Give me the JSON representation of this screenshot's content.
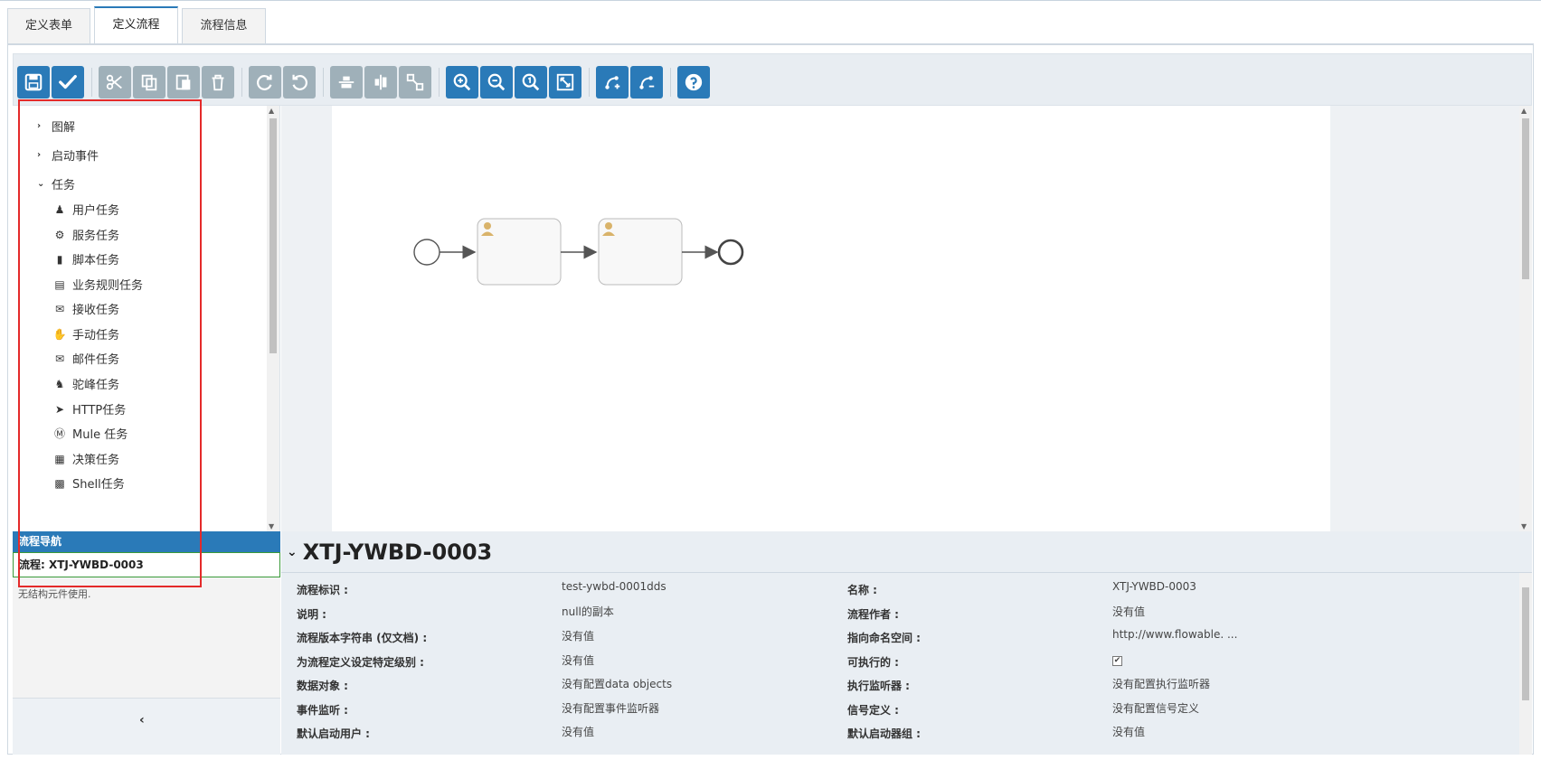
{
  "tabs": [
    {
      "label": "定义表单"
    },
    {
      "label": "定义流程"
    },
    {
      "label": "流程信息"
    }
  ],
  "toolbar": {
    "buttons": [
      "save-icon",
      "check-icon",
      "cut-icon",
      "copy-icon",
      "paste-icon",
      "delete-icon",
      "redo-icon",
      "undo-icon",
      "align-horizontal-icon",
      "align-vertical-icon",
      "resize-icon",
      "zoom-in-icon",
      "zoom-out-icon",
      "zoom-actual-icon",
      "fit-screen-icon",
      "add-bendpoint-icon",
      "remove-bendpoint-icon",
      "help-icon"
    ]
  },
  "palette": {
    "groups": [
      {
        "label": "图解",
        "expanded": false
      },
      {
        "label": "启动事件",
        "expanded": false
      },
      {
        "label": "任务",
        "expanded": true
      }
    ],
    "items": [
      {
        "label": "用户任务",
        "icon": "user-icon"
      },
      {
        "label": "服务任务",
        "icon": "gear-icon"
      },
      {
        "label": "脚本任务",
        "icon": "script-icon"
      },
      {
        "label": "业务规则任务",
        "icon": "table-icon"
      },
      {
        "label": "接收任务",
        "icon": "envelope-open-icon"
      },
      {
        "label": "手动任务",
        "icon": "hand-icon"
      },
      {
        "label": "邮件任务",
        "icon": "envelope-icon"
      },
      {
        "label": "驼峰任务",
        "icon": "camel-icon"
      },
      {
        "label": "HTTP任务",
        "icon": "rocket-icon"
      },
      {
        "label": "Mule 任务",
        "icon": "mule-icon"
      },
      {
        "label": "决策任务",
        "icon": "grid-icon"
      },
      {
        "label": "Shell任务",
        "icon": "terminal-icon"
      }
    ]
  },
  "navigation": {
    "header": "流程导航",
    "current": "流程: XTJ-YWBD-0003",
    "note": "无结构元件使用."
  },
  "properties": {
    "title": "XTJ-YWBD-0003",
    "rows": [
      {
        "label": "流程标识 :",
        "value": "test-ywbd-0001dds",
        "label2": "名称 :",
        "value2": "XTJ-YWBD-0003"
      },
      {
        "label": "说明 :",
        "value": "null的副本",
        "label2": "流程作者 :",
        "value2": "没有值"
      },
      {
        "label": "流程版本字符串 (仅文档) :",
        "value": "没有值",
        "label2": "指向命名空间 :",
        "value2": "http://www.flowable. ..."
      },
      {
        "label": "为流程定义设定特定级别 :",
        "value": "没有值",
        "label2": "可执行的 :",
        "value2": "✔"
      },
      {
        "label": "数据对象 :",
        "value": "没有配置data objects",
        "label2": "执行监听器 :",
        "value2": "没有配置执行监听器"
      },
      {
        "label": "事件监听 :",
        "value": "没有配置事件监听器",
        "label2": "信号定义 :",
        "value2": "没有配置信号定义"
      },
      {
        "label": "默认启动用户 :",
        "value": "没有值",
        "label2": "默认启动器组 :",
        "value2": "没有值"
      }
    ]
  },
  "colors": {
    "accent": "#2a7ab8",
    "highlight": "#e42a2a"
  }
}
